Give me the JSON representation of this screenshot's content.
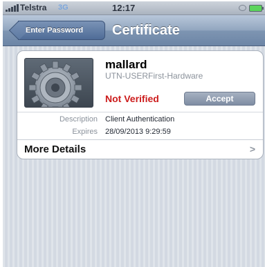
{
  "status_bar": {
    "carrier": "Telstra",
    "network": "3G",
    "time": "12:17",
    "signal_icon": "signal-bars-icon",
    "alarm_icon": "alarm-icon",
    "battery_icon": "battery-icon",
    "battery_color": "#5bd45b"
  },
  "nav": {
    "back_label": "Enter Password",
    "title": "Certificate",
    "bar_color": "#7e95b2"
  },
  "certificate": {
    "icon": "gear-icon",
    "name": "mallard",
    "issuer": "UTN-USERFirst-Hardware",
    "status": "Not Verified",
    "status_color": "#cc1b1b",
    "accept_label": "Accept",
    "details": [
      {
        "label": "Description",
        "value": "Client Authentication"
      },
      {
        "label": "Expires",
        "value": "28/09/2013 9:29:59"
      }
    ],
    "more_details_label": "More Details",
    "more_details_chevron": ">"
  }
}
